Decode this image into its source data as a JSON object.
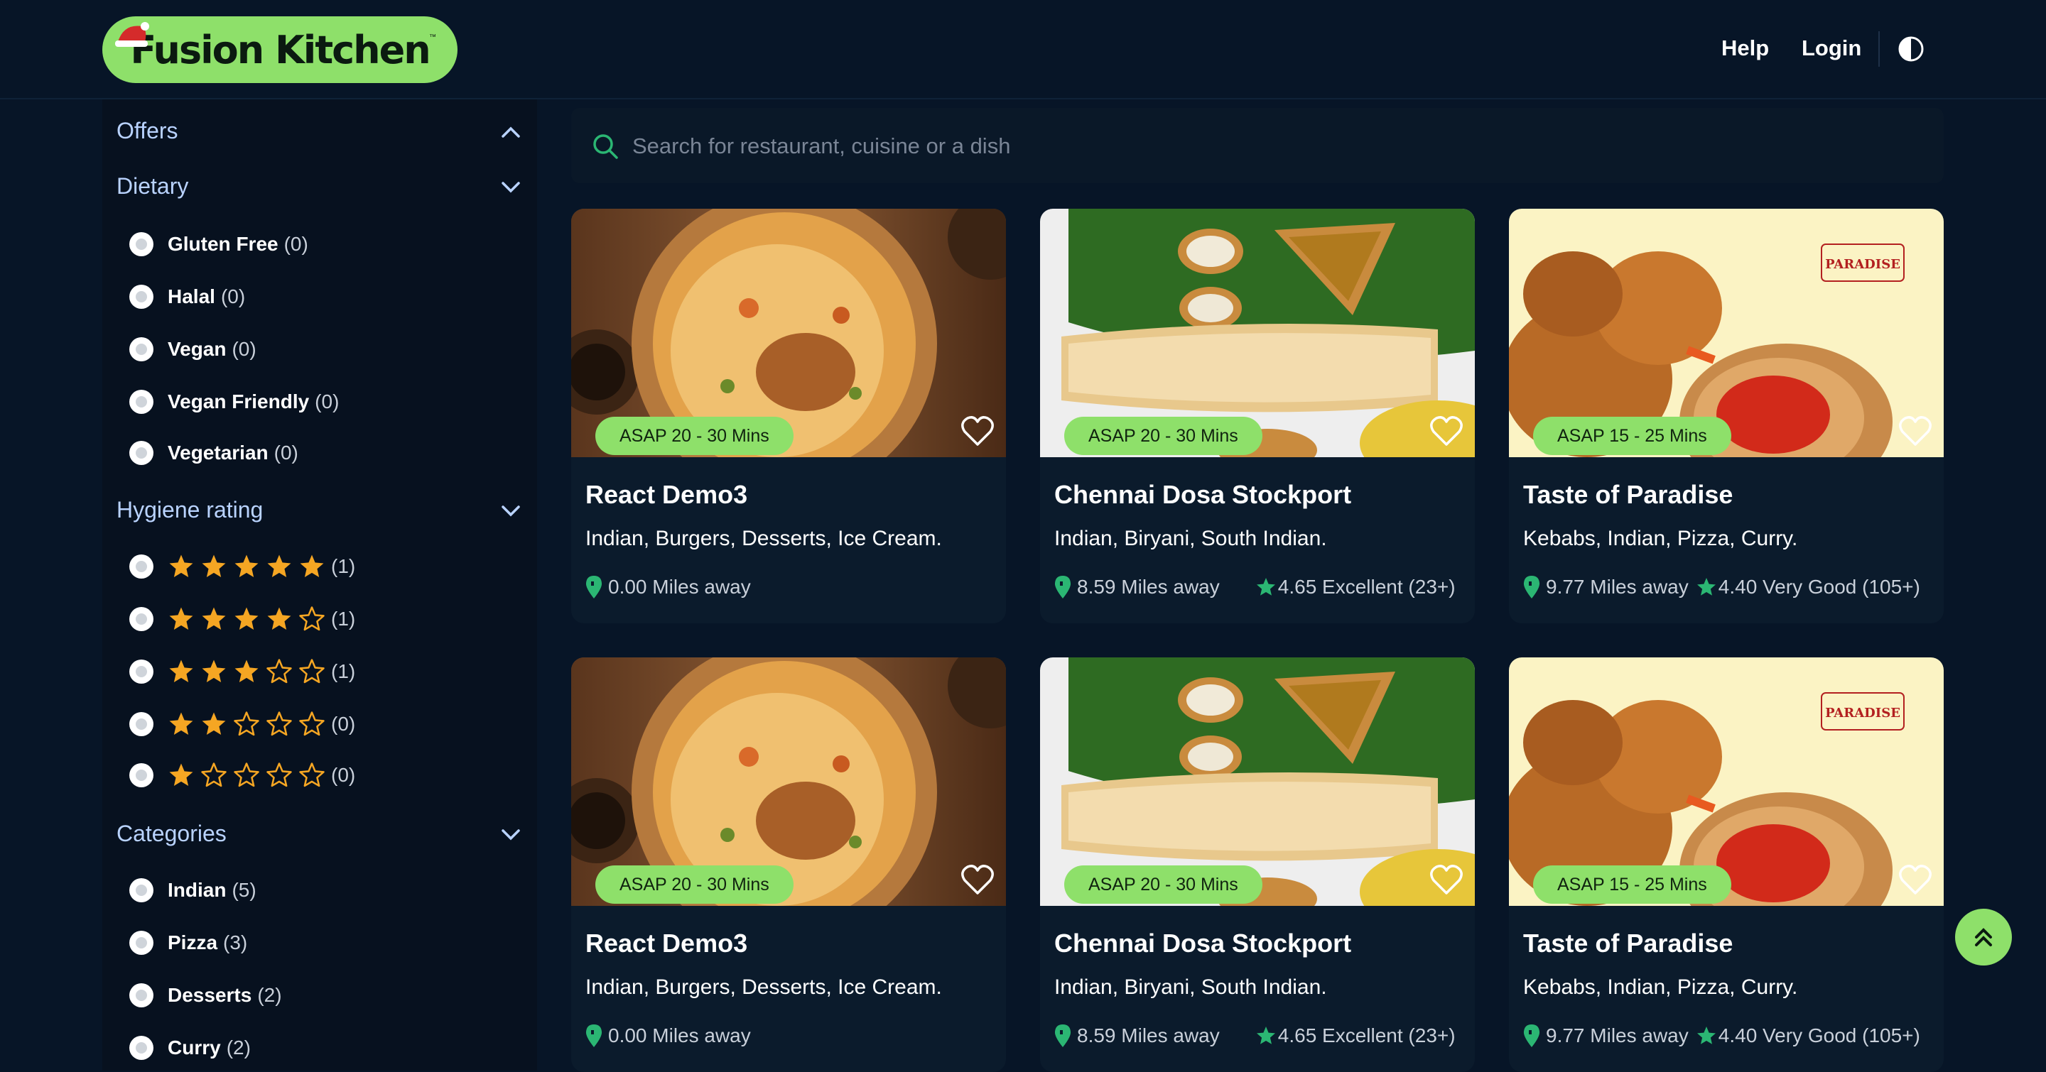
{
  "header": {
    "logo_text": "Fusion Kitchen",
    "logo_tm": "™",
    "help_label": "Help",
    "login_label": "Login",
    "theme_icon": "contrast-half-circle-icon"
  },
  "sidebar": {
    "offers_title": "Offers",
    "dietary_title": "Dietary",
    "dietary": [
      {
        "label": "Gluten Free",
        "count": "(0)"
      },
      {
        "label": "Halal",
        "count": "(0)"
      },
      {
        "label": "Vegan",
        "count": "(0)"
      },
      {
        "label": "Vegan Friendly",
        "count": "(0)"
      },
      {
        "label": "Vegetarian",
        "count": "(0)"
      }
    ],
    "hygiene_title": "Hygiene rating",
    "hygiene": [
      {
        "stars": 5,
        "count": "(1)"
      },
      {
        "stars": 4,
        "count": "(1)"
      },
      {
        "stars": 3,
        "count": "(1)"
      },
      {
        "stars": 2,
        "count": "(0)"
      },
      {
        "stars": 1,
        "count": "(0)"
      }
    ],
    "categories_title": "Categories",
    "categories": [
      {
        "label": "Indian",
        "count": "(5)"
      },
      {
        "label": "Pizza",
        "count": "(3)"
      },
      {
        "label": "Desserts",
        "count": "(2)"
      },
      {
        "label": "Curry",
        "count": "(2)"
      }
    ]
  },
  "search": {
    "placeholder": "Search for restaurant, cuisine or a dish"
  },
  "restaurants": [
    {
      "name": "React Demo3",
      "time": "ASAP 20 - 30 Mins",
      "cuisine": "Indian, Burgers, Desserts, Ice Cream.",
      "distance": "0.00 Miles away",
      "rating": "",
      "image": "biryani"
    },
    {
      "name": "Chennai Dosa Stockport",
      "time": "ASAP 20 - 30 Mins",
      "cuisine": "Indian, Biryani, South Indian.",
      "distance": "8.59 Miles away",
      "rating": "4.65 Excellent (23+)",
      "image": "dosa"
    },
    {
      "name": "Taste of Paradise",
      "time": "ASAP 15 - 25 Mins",
      "cuisine": "Kebabs, Indian, Pizza, Curry.",
      "distance": "9.77 Miles away",
      "rating": "4.40 Very Good (105+)",
      "image": "fried-chicken",
      "image_logo": "PARADISE"
    },
    {
      "name": "React Demo3",
      "time": "ASAP 20 - 30 Mins",
      "cuisine": "Indian, Burgers, Desserts, Ice Cream.",
      "distance": "0.00 Miles away",
      "rating": "",
      "image": "biryani"
    },
    {
      "name": "Chennai Dosa Stockport",
      "time": "ASAP 20 - 30 Mins",
      "cuisine": "Indian, Biryani, South Indian.",
      "distance": "8.59 Miles away",
      "rating": "4.65 Excellent (23+)",
      "image": "dosa"
    },
    {
      "name": "Taste of Paradise",
      "time": "ASAP 15 - 25 Mins",
      "cuisine": "Kebabs, Indian, Pizza, Curry.",
      "distance": "9.77 Miles away",
      "rating": "4.40 Very Good (105+)",
      "image": "fried-chicken",
      "image_logo": "PARADISE"
    }
  ],
  "colors": {
    "accent": "#8ee06a",
    "background": "#071527",
    "star": "#f5a623",
    "rating_star": "#2bb673",
    "pin": "#2bb673"
  }
}
